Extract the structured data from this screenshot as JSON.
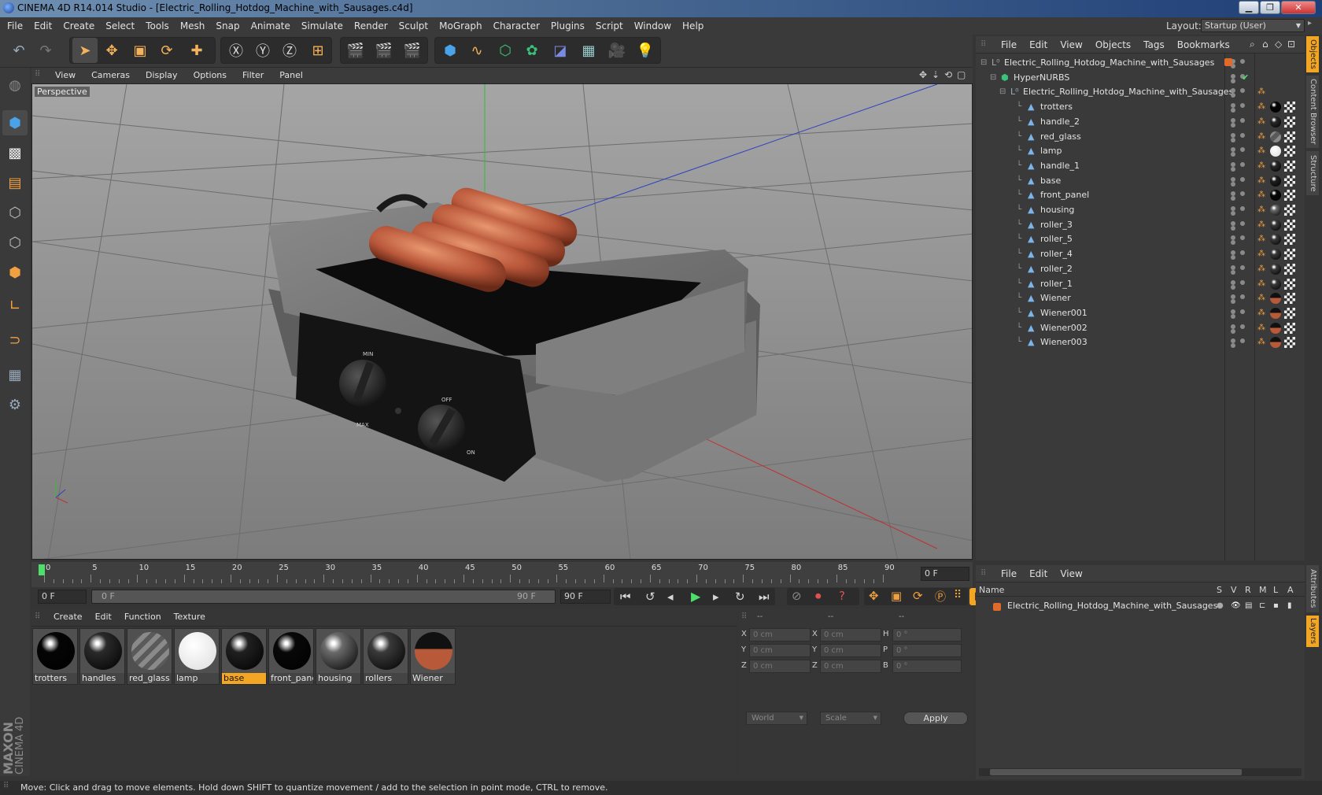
{
  "window": {
    "title": "CINEMA 4D R14.014 Studio - [Electric_Rolling_Hotdog_Machine_with_Sausages.c4d]",
    "minimize": "▁",
    "maximize": "❐",
    "close": "✕"
  },
  "menubar": {
    "items": [
      "File",
      "Edit",
      "Create",
      "Select",
      "Tools",
      "Mesh",
      "Snap",
      "Animate",
      "Simulate",
      "Render",
      "Sculpt",
      "MoGraph",
      "Character",
      "Plugins",
      "Script",
      "Window",
      "Help"
    ],
    "layout_label": "Layout:",
    "layout_value": "Startup (User)"
  },
  "viewport": {
    "menu": [
      "View",
      "Cameras",
      "Display",
      "Options",
      "Filter",
      "Panel"
    ],
    "label": "Perspective",
    "knob_labels": {
      "min": "MIN",
      "max": "MAX",
      "off": "OFF",
      "on": "ON"
    }
  },
  "timeline": {
    "ticks": [
      "0",
      "5",
      "10",
      "15",
      "20",
      "25",
      "30",
      "35",
      "40",
      "45",
      "50",
      "55",
      "60",
      "65",
      "70",
      "75",
      "80",
      "85",
      "90"
    ],
    "current_frame": "0 F",
    "start_field": "0 F",
    "range_start": "0 F",
    "range_end": "90 F",
    "end_field": "90 F"
  },
  "material_manager": {
    "menu": [
      "Create",
      "Edit",
      "Function",
      "Texture"
    ],
    "materials": [
      {
        "name": "trotters",
        "color": "#050505"
      },
      {
        "name": "handles",
        "color": "#2a2a2a"
      },
      {
        "name": "red_glass",
        "color": "striped"
      },
      {
        "name": "lamp",
        "color": "#ffffff"
      },
      {
        "name": "base",
        "color": "#202020"
      },
      {
        "name": "front_pane",
        "color": "#080808"
      },
      {
        "name": "housing",
        "color": "#6a6a6a"
      },
      {
        "name": "rollers",
        "color": "#3a3a3a"
      },
      {
        "name": "Wiener",
        "color": "#b85a3a"
      }
    ],
    "selected": "base"
  },
  "coordinates": {
    "headers": [
      "--",
      "--",
      "--"
    ],
    "rows": [
      {
        "a": "X",
        "av": "0 cm",
        "b": "X",
        "bv": "0 cm",
        "c": "H",
        "cv": "0 °"
      },
      {
        "a": "Y",
        "av": "0 cm",
        "b": "Y",
        "bv": "0 cm",
        "c": "P",
        "cv": "0 °"
      },
      {
        "a": "Z",
        "av": "0 cm",
        "b": "Z",
        "bv": "0 cm",
        "c": "B",
        "cv": "0 °"
      }
    ],
    "space": "World",
    "mode": "Scale",
    "apply": "Apply"
  },
  "object_manager": {
    "menu": [
      "File",
      "Edit",
      "View",
      "Objects",
      "Tags",
      "Bookmarks"
    ],
    "root": "Electric_Rolling_Hotdog_Machine_with_Sausages",
    "hypernurbs": "HyperNURBS",
    "group": "Electric_Rolling_Hotdog_Machine_with_Sausages",
    "children": [
      {
        "name": "trotters",
        "mat": "#050505"
      },
      {
        "name": "handle_2",
        "mat": "#2a2a2a"
      },
      {
        "name": "red_glass",
        "mat": "striped"
      },
      {
        "name": "lamp",
        "mat": "#ffffff"
      },
      {
        "name": "handle_1",
        "mat": "#2a2a2a"
      },
      {
        "name": "base",
        "mat": "#202020"
      },
      {
        "name": "front_panel",
        "mat": "#080808"
      },
      {
        "name": "housing",
        "mat": "#6a6a6a"
      },
      {
        "name": "roller_3",
        "mat": "#3a3a3a"
      },
      {
        "name": "roller_5",
        "mat": "#3a3a3a"
      },
      {
        "name": "roller_4",
        "mat": "#3a3a3a"
      },
      {
        "name": "roller_2",
        "mat": "#3a3a3a"
      },
      {
        "name": "roller_1",
        "mat": "#3a3a3a"
      },
      {
        "name": "Wiener",
        "mat": "#b85a3a"
      },
      {
        "name": "Wiener001",
        "mat": "#b85a3a"
      },
      {
        "name": "Wiener002",
        "mat": "#b85a3a"
      },
      {
        "name": "Wiener003",
        "mat": "#b85a3a"
      }
    ]
  },
  "layer_manager": {
    "menu": [
      "File",
      "Edit",
      "View"
    ],
    "columns": [
      "Name",
      "S",
      "V",
      "R",
      "M",
      "L",
      "A"
    ],
    "layer": "Electric_Rolling_Hotdog_Machine_with_Sausages"
  },
  "side_tabs": [
    "Objects",
    "Content Browser",
    "Structure",
    "Attributes",
    "Layers"
  ],
  "branding": {
    "maxon": "MAXON",
    "cinema": "CINEMA 4D"
  },
  "status": "Move: Click and drag to move elements. Hold down SHIFT to quantize movement / add to the selection in point mode, CTRL to remove.",
  "colors": {
    "accent": "#f2a623",
    "x_axis": "#c03030",
    "y_axis": "#30c030",
    "z_axis": "#3040c0"
  }
}
